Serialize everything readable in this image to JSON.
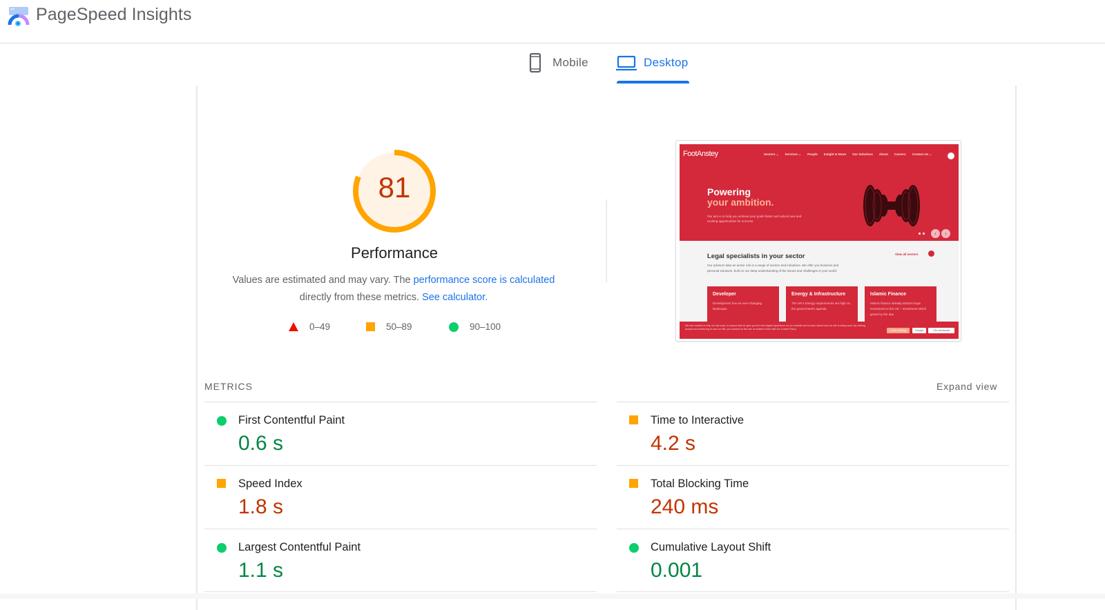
{
  "header": {
    "app_title": "PageSpeed Insights",
    "logo_icon": "pagespeed-gauge-logo"
  },
  "tabs": [
    {
      "label": "Mobile",
      "icon": "smartphone-icon",
      "selected": false
    },
    {
      "label": "Desktop",
      "icon": "laptop-icon",
      "selected": true
    }
  ],
  "performance": {
    "score": "81",
    "score_value": 81,
    "score_max": 100,
    "title": "Performance",
    "desc_prefix": "Values are estimated and may vary. The ",
    "desc_link1": "performance score is calculated",
    "desc_middle": " directly from these metrics. ",
    "desc_link2": "See calculator.",
    "colors": {
      "ring": "#ffa400",
      "score_text": "#c33300",
      "fill": "#fff3e6"
    }
  },
  "legend": [
    {
      "shape": "triangle",
      "range": "0–49",
      "color": "#eb0f00"
    },
    {
      "shape": "square",
      "range": "50–89",
      "color": "#ffa400"
    },
    {
      "shape": "circle",
      "range": "90–100",
      "color": "#0cce6b"
    }
  ],
  "screenshot": {
    "site_logo": "FootAnstey",
    "nav": [
      "Sectors ⌄",
      "Services ⌄",
      "People",
      "Insight & News",
      "Our Solutions",
      "About",
      "Careers",
      "Contact Us ⌄"
    ],
    "hero_line1": "Powering",
    "hero_line2": "your ambition.",
    "hero_text": "Our aim is to help you achieve your goals faster and unlock new and exciting opportunities for success.",
    "section_title": "Legal specialists in your sector",
    "section_link": "View all sectors",
    "section_text": "Our advisers take an active role in a range of sectors and industries. We offer you business and personal solutions, built on our deep understanding of the issues and challenges in your world.",
    "cards": [
      {
        "title": "Developer",
        "text": "Development has an ever-changing landscape."
      },
      {
        "title": "Energy & Infrastructure",
        "text": "The UK's Energy requirements are high on the government's agenda"
      },
      {
        "title": "Islamic Finance",
        "text": "Islamic finance already attracts huge investment to the UK – investment which grows by the day"
      }
    ],
    "cookie_text": "We use cookies to help our site work, to ensure that we give you the best digital experience on our website and to learn about how our site is being used. By clicking accept and continuing to use our site, you consent to the use of cookies in line with our Cookie Policy",
    "cookie_buttons": [
      "Cookie Settings",
      "I Accept",
      "I Do Not Accept"
    ]
  },
  "metrics": {
    "title": "METRICS",
    "expand_label": "Expand view",
    "items": [
      {
        "label": "First Contentful Paint",
        "value": "0.6 s",
        "rating": "good"
      },
      {
        "label": "Time to Interactive",
        "value": "4.2 s",
        "rating": "average"
      },
      {
        "label": "Speed Index",
        "value": "1.8 s",
        "rating": "average"
      },
      {
        "label": "Total Blocking Time",
        "value": "240 ms",
        "rating": "average"
      },
      {
        "label": "Largest Contentful Paint",
        "value": "1.1 s",
        "rating": "good"
      },
      {
        "label": "Cumulative Layout Shift",
        "value": "0.001",
        "rating": "good"
      }
    ]
  }
}
